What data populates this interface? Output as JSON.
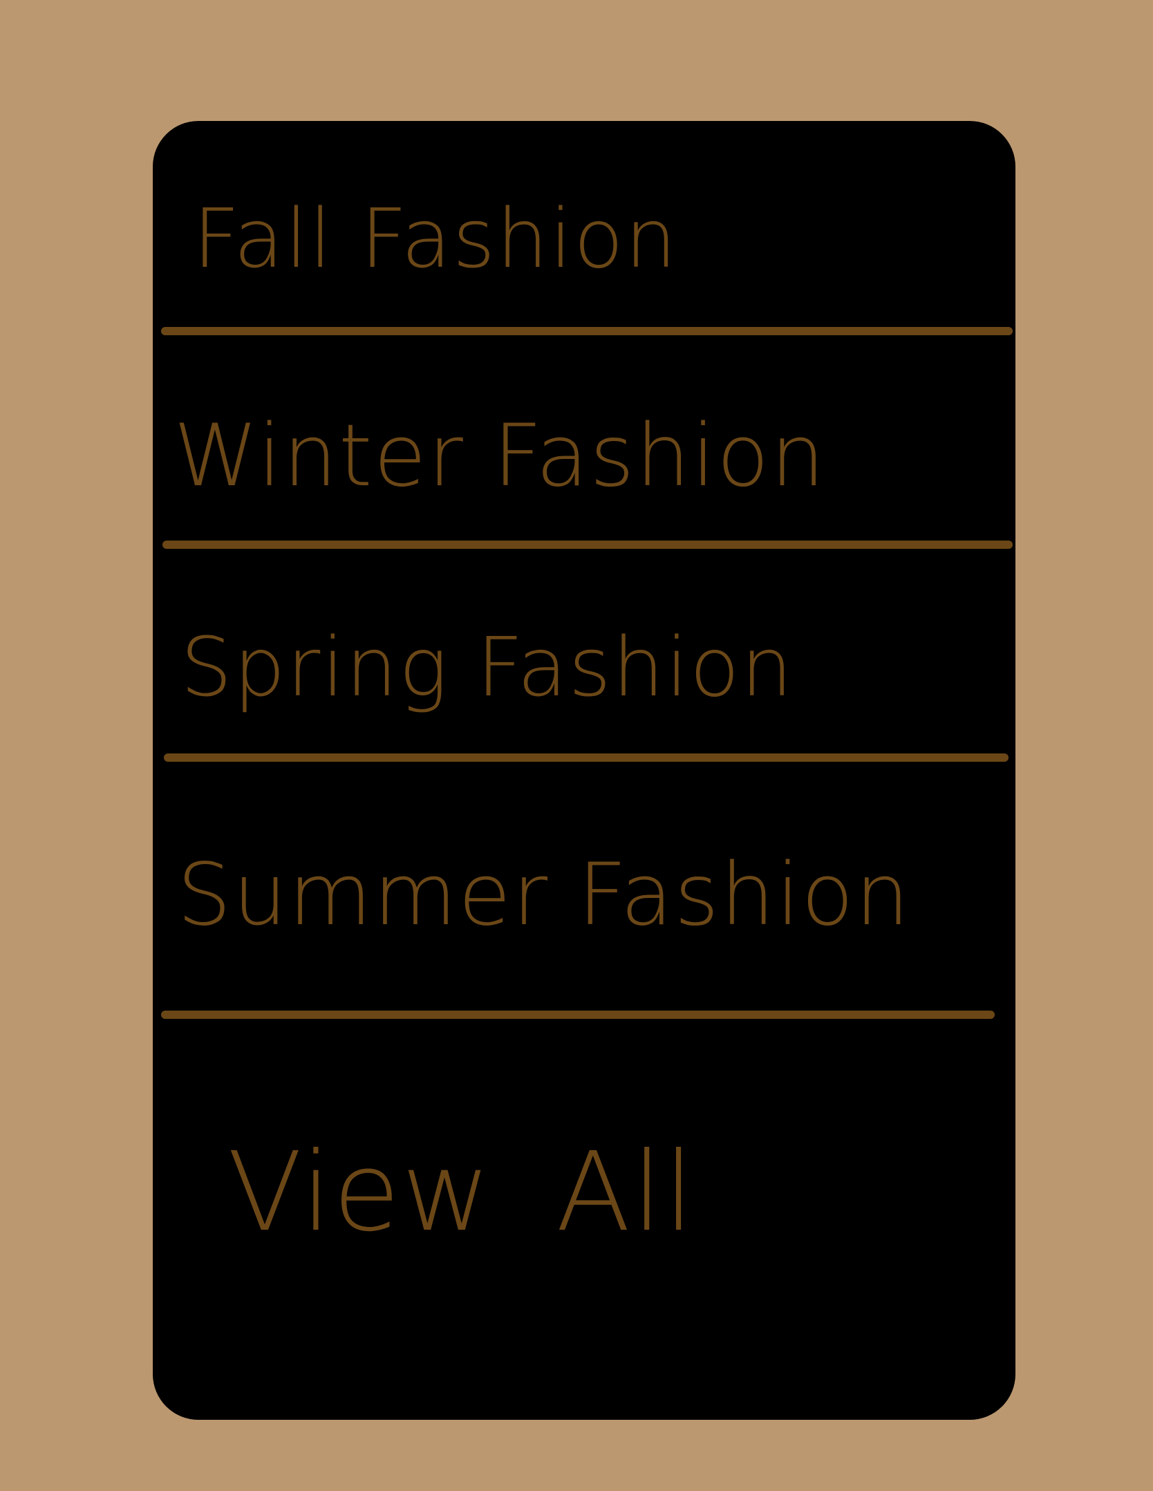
{
  "menu": {
    "items": [
      {
        "label": "Fall Fashion"
      },
      {
        "label": "Winter Fashion"
      },
      {
        "label": "Spring Fashion"
      },
      {
        "label": "Summer Fashion"
      }
    ],
    "view_all_label": "View All"
  },
  "colors": {
    "background": "#bb9870",
    "card": "#000000",
    "accent": "#6b4717"
  }
}
